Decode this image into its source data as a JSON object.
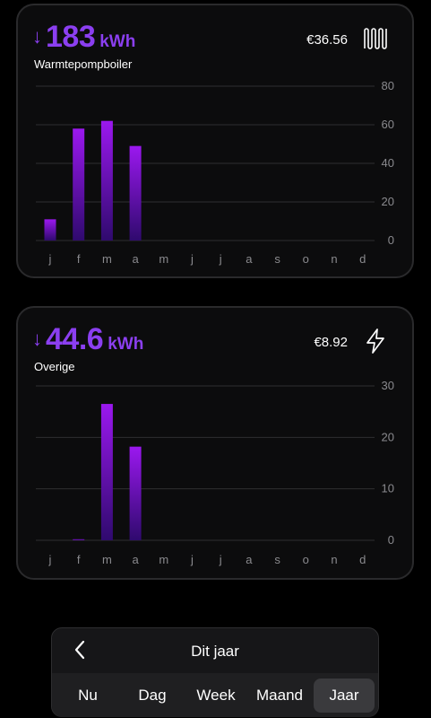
{
  "cards": [
    {
      "value": "183",
      "unit": "kWh",
      "label": "Warmtepompboiler",
      "cost": "€36.56",
      "icon": "radiator-icon",
      "chart_data": {
        "type": "bar",
        "categories": [
          "j",
          "f",
          "m",
          "a",
          "m",
          "j",
          "j",
          "a",
          "s",
          "o",
          "n",
          "d"
        ],
        "values": [
          11,
          58,
          62,
          49,
          0,
          0,
          0,
          0,
          0,
          0,
          0,
          0
        ],
        "ylim": [
          0,
          80
        ],
        "yticks": [
          0,
          20,
          40,
          60,
          80
        ]
      }
    },
    {
      "value": "44.6",
      "unit": "kWh",
      "label": "Overige",
      "cost": "€8.92",
      "icon": "lightning-icon",
      "chart_data": {
        "type": "bar",
        "categories": [
          "j",
          "f",
          "m",
          "a",
          "m",
          "j",
          "j",
          "a",
          "s",
          "o",
          "n",
          "d"
        ],
        "values": [
          0,
          0.2,
          26.5,
          18.2,
          0,
          0,
          0,
          0,
          0,
          0,
          0,
          0
        ],
        "ylim": [
          0,
          30
        ],
        "yticks": [
          0,
          10,
          20,
          30
        ]
      }
    }
  ],
  "menu": {
    "period_label": "Dit jaar",
    "tabs": [
      "Nu",
      "Dag",
      "Week",
      "Maand",
      "Jaar"
    ],
    "active_tab": "Jaar"
  },
  "colors": {
    "accent": "#8b3ff0",
    "bar_top": "#9b18ef",
    "bar_bottom": "#2f0a6e"
  }
}
